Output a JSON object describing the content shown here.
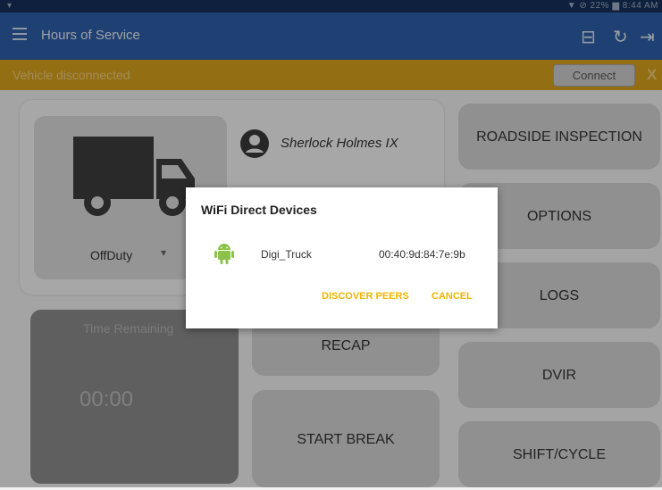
{
  "status_bar": {
    "right_text": "▼ ⊘ 22% ▆ 8:44 AM"
  },
  "app_bar": {
    "title": "Hours of Service"
  },
  "banner": {
    "message": "Vehicle disconnected",
    "connect_label": "Connect",
    "close_label": "X"
  },
  "driver": {
    "name": "Sherlock Holmes IX"
  },
  "duty_status": {
    "selected": "OffDuty"
  },
  "time_remaining": {
    "label": "Time Remaining",
    "value": "00:00"
  },
  "buttons": {
    "recap": "RECAP",
    "start_break": "START BREAK",
    "roadside_inspection": "ROADSIDE INSPECTION",
    "options": "OPTIONS",
    "logs": "LOGS",
    "dvir": "DVIR",
    "shift_cycle": "SHIFT/CYCLE"
  },
  "dialog": {
    "title": "WiFi Direct Devices",
    "devices": [
      {
        "name": "Digi_Truck",
        "address": "00:40:9d:84:7e:9b"
      }
    ],
    "discover_label": "DISCOVER PEERS",
    "cancel_label": "CANCEL"
  },
  "colors": {
    "app_bar": "#2f5fa8",
    "banner": "#d9a21c",
    "accent": "#f2b400",
    "android_green": "#8bc34a"
  }
}
